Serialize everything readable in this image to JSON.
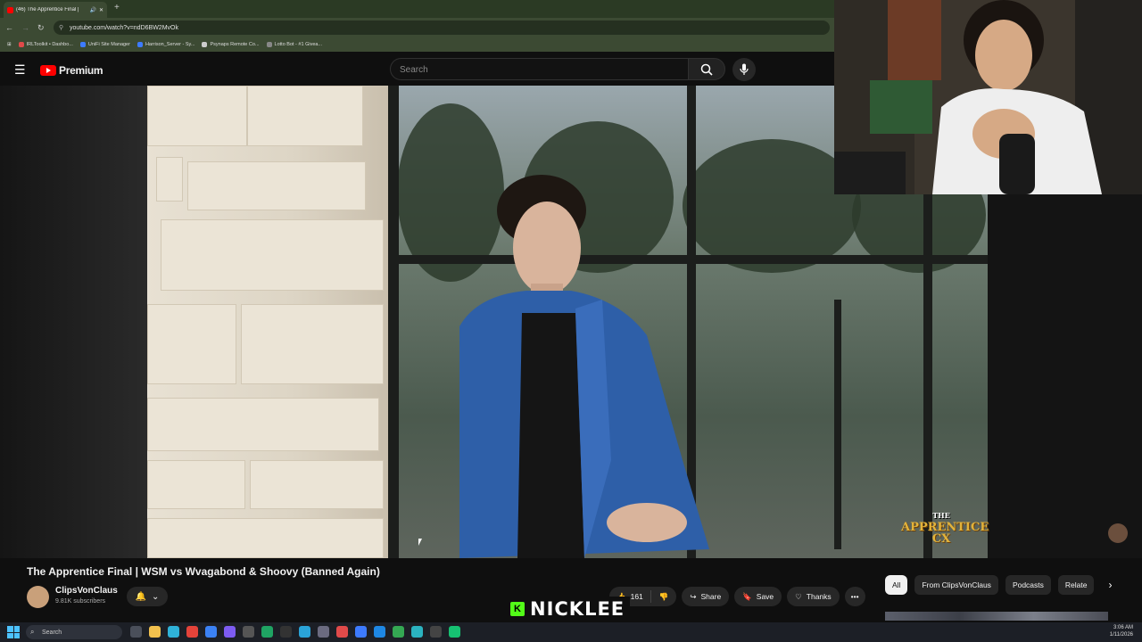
{
  "browser": {
    "tab_title": "(46) The Apprentice Final | ",
    "new_tab": "+",
    "url": "youtube.com/watch?v=ndD6BW2MvOk",
    "bookmarks": [
      {
        "label": "IRLToolkit • Dashbo...",
        "color": "#e04a4a"
      },
      {
        "label": "UniFi Site Manager",
        "color": "#3d7bff"
      },
      {
        "label": "Harrison_Server - Sy...",
        "color": "#3d7bff"
      },
      {
        "label": "Psynaps Remote Co...",
        "color": "#cccccc"
      },
      {
        "label": "Lotto Bot - #1 Givea...",
        "color": "#888888"
      }
    ]
  },
  "youtube": {
    "logo_text": "Premium",
    "search_placeholder": "Search"
  },
  "video": {
    "title": "The Apprentice Final | WSM vs Wvagabond & Shoovy (Banned Again)",
    "watermark_line1": "THE",
    "watermark_line2": "APPRENTICE",
    "watermark_line3": "CX"
  },
  "channel": {
    "name": "ClipsVonClaus",
    "subscribers": "9.81K subscribers"
  },
  "actions": {
    "likes": "161",
    "share": "Share",
    "save": "Save",
    "thanks": "Thanks",
    "more": "•••"
  },
  "chips": [
    "All",
    "From ClipsVonClaus",
    "Podcasts",
    "Relate"
  ],
  "stream_overlay": {
    "badge": "K",
    "name": "NICKLEE"
  },
  "taskbar": {
    "search_placeholder": "Search",
    "time": "3:06 AM",
    "date": "1/11/2026"
  },
  "colors": {
    "youtube_red": "#ff0000",
    "kick_green": "#53fc18",
    "background": "#0f0f0f"
  }
}
